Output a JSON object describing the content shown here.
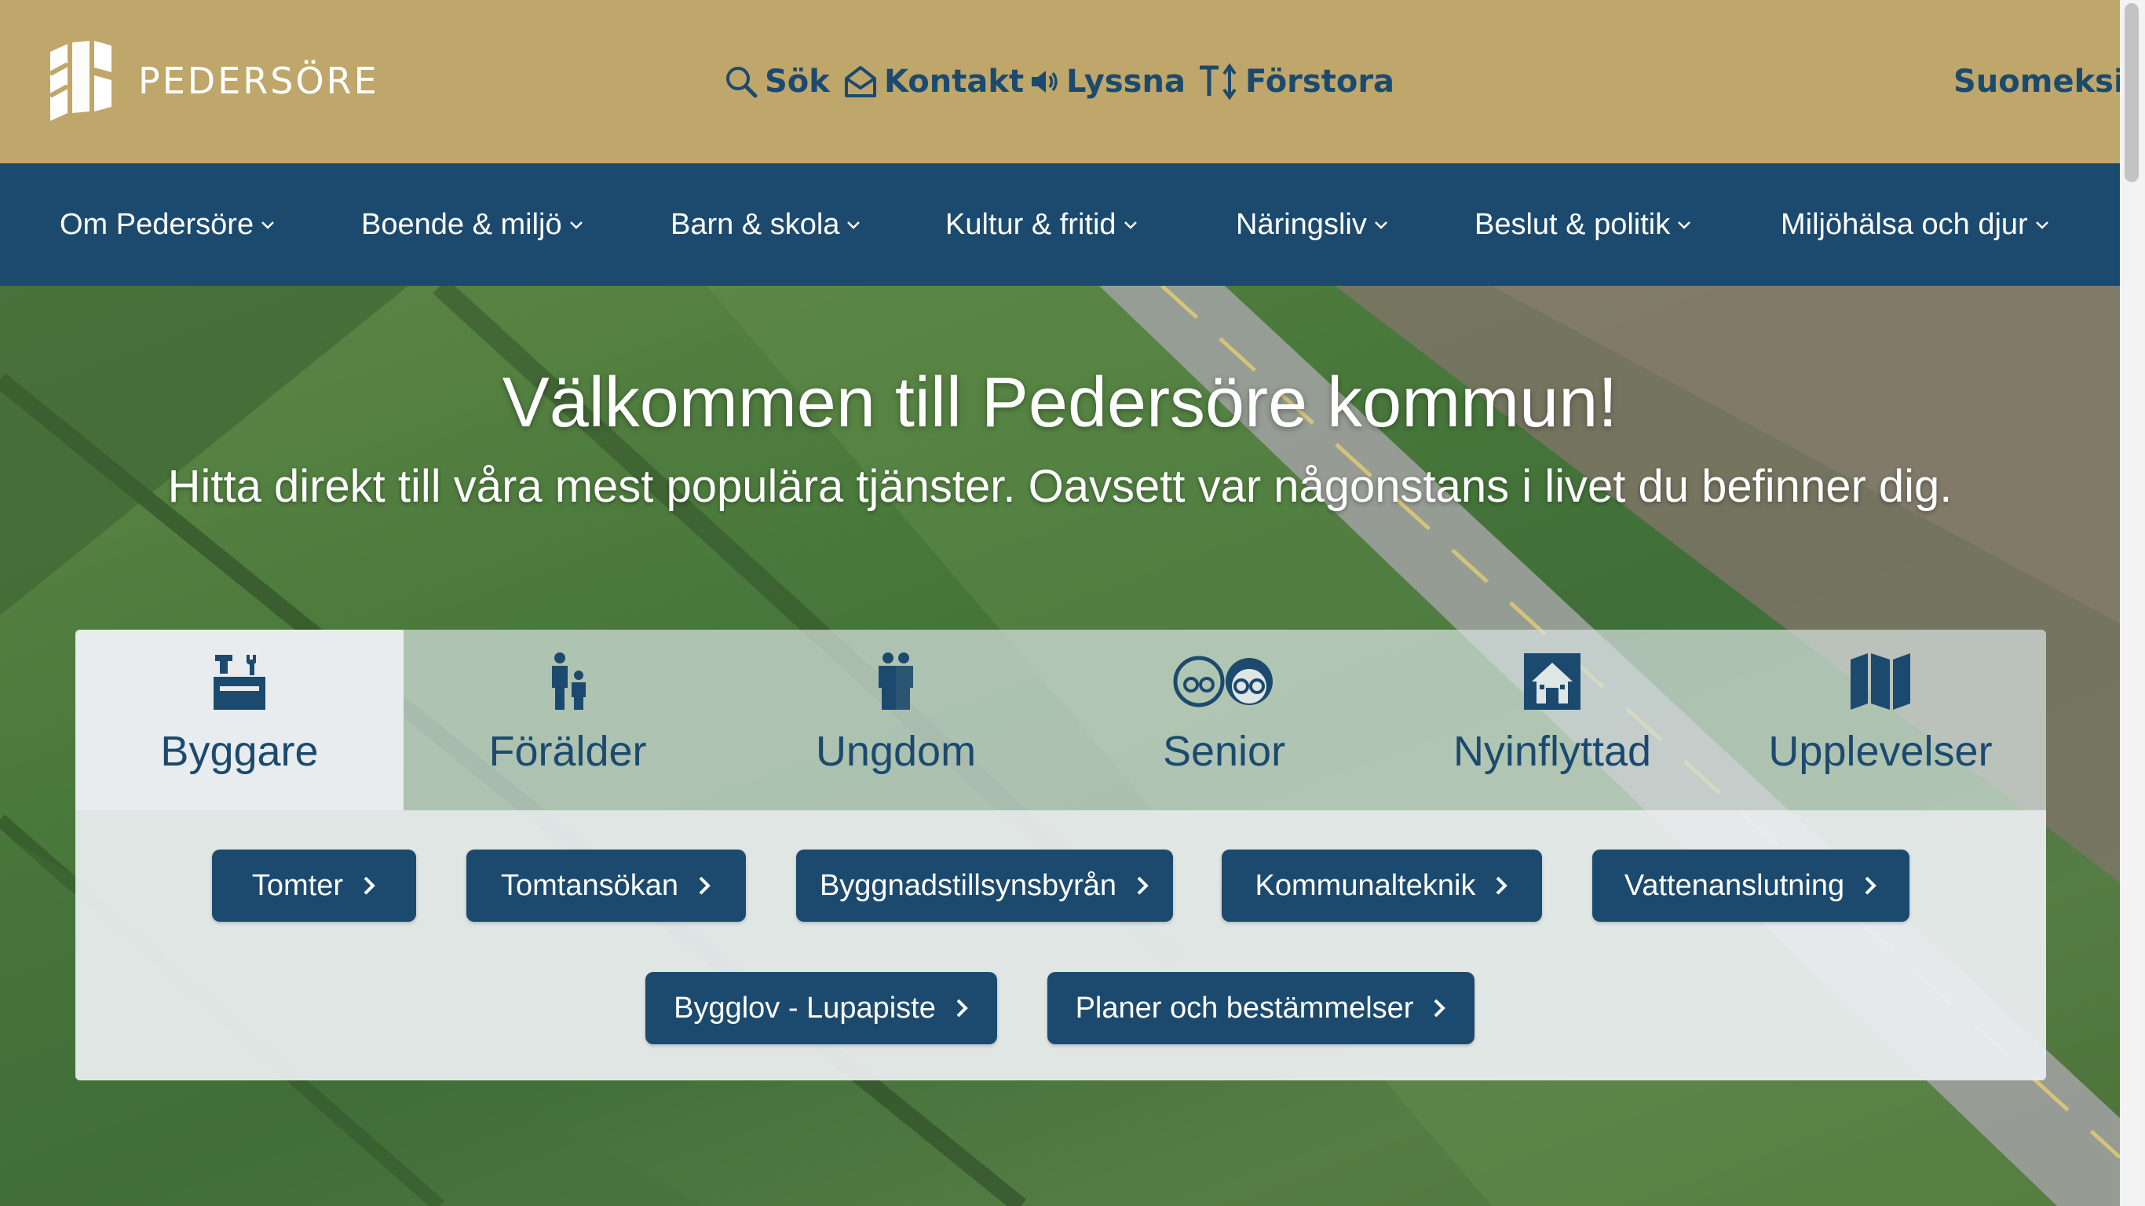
{
  "brand": {
    "name": "PEDERSÖRE",
    "text_color": "#ffffff",
    "bar_color": "#bfa66a"
  },
  "utility_links": {
    "search": {
      "label": "Sök",
      "icon": "search-icon"
    },
    "contact": {
      "label": "Kontakt",
      "icon": "envelope-open-icon"
    },
    "listen": {
      "label": "Lyssna",
      "icon": "speaker-icon"
    },
    "zoom": {
      "label": "Förstora",
      "icon": "text-size-icon"
    },
    "language": {
      "label": "Suomeksi"
    }
  },
  "nav": {
    "color": "#1c4a6e",
    "items": [
      {
        "label": "Om Pedersöre"
      },
      {
        "label": "Boende & miljö"
      },
      {
        "label": "Barn & skola"
      },
      {
        "label": "Kultur & fritid"
      },
      {
        "label": "Näringsliv"
      },
      {
        "label": "Beslut & politik"
      },
      {
        "label": "Miljöhälsa och djur"
      }
    ]
  },
  "hero": {
    "title": "Välkommen till Pedersöre kommun!",
    "subtitle": "Hitta direkt till våra mest populära tjänster. Oavsett var någonstans i livet du befinner dig."
  },
  "tabs": {
    "active": "Byggare",
    "items": [
      {
        "label": "Byggare",
        "icon": "toolbox-icon"
      },
      {
        "label": "Förälder",
        "icon": "parent-child-icon"
      },
      {
        "label": "Ungdom",
        "icon": "youth-icon"
      },
      {
        "label": "Senior",
        "icon": "seniors-icon"
      },
      {
        "label": "Nyinflyttad",
        "icon": "house-icon"
      },
      {
        "label": "Upplevelser",
        "icon": "map-icon"
      }
    ]
  },
  "services": {
    "items": [
      {
        "label": "Tomter"
      },
      {
        "label": "Tomtansökan"
      },
      {
        "label": "Byggnadstillsynsbyrån"
      },
      {
        "label": "Kommunalteknik"
      },
      {
        "label": "Vattenanslutning"
      },
      {
        "label": "Bygglov - Lupapiste"
      },
      {
        "label": "Planer och bestämmelser"
      }
    ]
  }
}
